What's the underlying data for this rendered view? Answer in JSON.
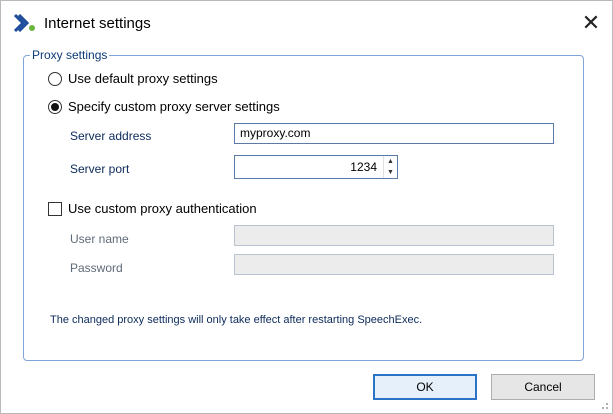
{
  "window": {
    "title": "Internet settings",
    "close_glyph": "✕",
    "app_icon": "speechexec-logo-icon"
  },
  "proxy": {
    "group_label": "Proxy settings",
    "use_default_label": "Use default proxy settings",
    "use_default_checked": false,
    "custom_label": "Specify custom proxy server settings",
    "custom_checked": true,
    "server_address_label": "Server address",
    "server_address_value": "myproxy.com",
    "server_port_label": "Server port",
    "server_port_value": "1234",
    "spin_up_glyph": "▲",
    "spin_down_glyph": "▼"
  },
  "auth": {
    "checkbox_label": "Use custom proxy authentication",
    "checked": false,
    "username_label": "User name",
    "username_value": "",
    "password_label": "Password",
    "password_value": ""
  },
  "info_text": "The changed proxy settings will only take effect after restarting SpeechExec.",
  "buttons": {
    "ok_label": "OK",
    "cancel_label": "Cancel"
  },
  "colors": {
    "group_border": "#7fa6d8",
    "default_button_border": "#2a73c7",
    "label_text": "#0c2a5a"
  }
}
